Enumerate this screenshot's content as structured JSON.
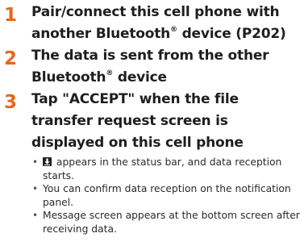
{
  "steps": [
    {
      "number": "1",
      "line1": "Pair/connect this cell phone with",
      "line2_before": "another Bluetooth",
      "line2_reg": "®",
      "line2_after": " device (P202)"
    },
    {
      "number": "2",
      "line1": "The data is sent from the other",
      "line2_before": "Bluetooth",
      "line2_reg": "®",
      "line2_after": " device"
    },
    {
      "number": "3",
      "text": "Tap \"ACCEPT\" when the file transfer request screen is displayed on this cell phone"
    }
  ],
  "notes": {
    "bullet": "•",
    "note1": "appears in the status bar, and data reception starts.",
    "note2": "You can confirm data reception on the notification panel.",
    "note3": "Message screen appears at the bottom screen after receiving data."
  },
  "icons": {
    "status_icon": "download-icon"
  },
  "colors": {
    "step_number": "#e8661c",
    "text": "#1e1e1e"
  }
}
